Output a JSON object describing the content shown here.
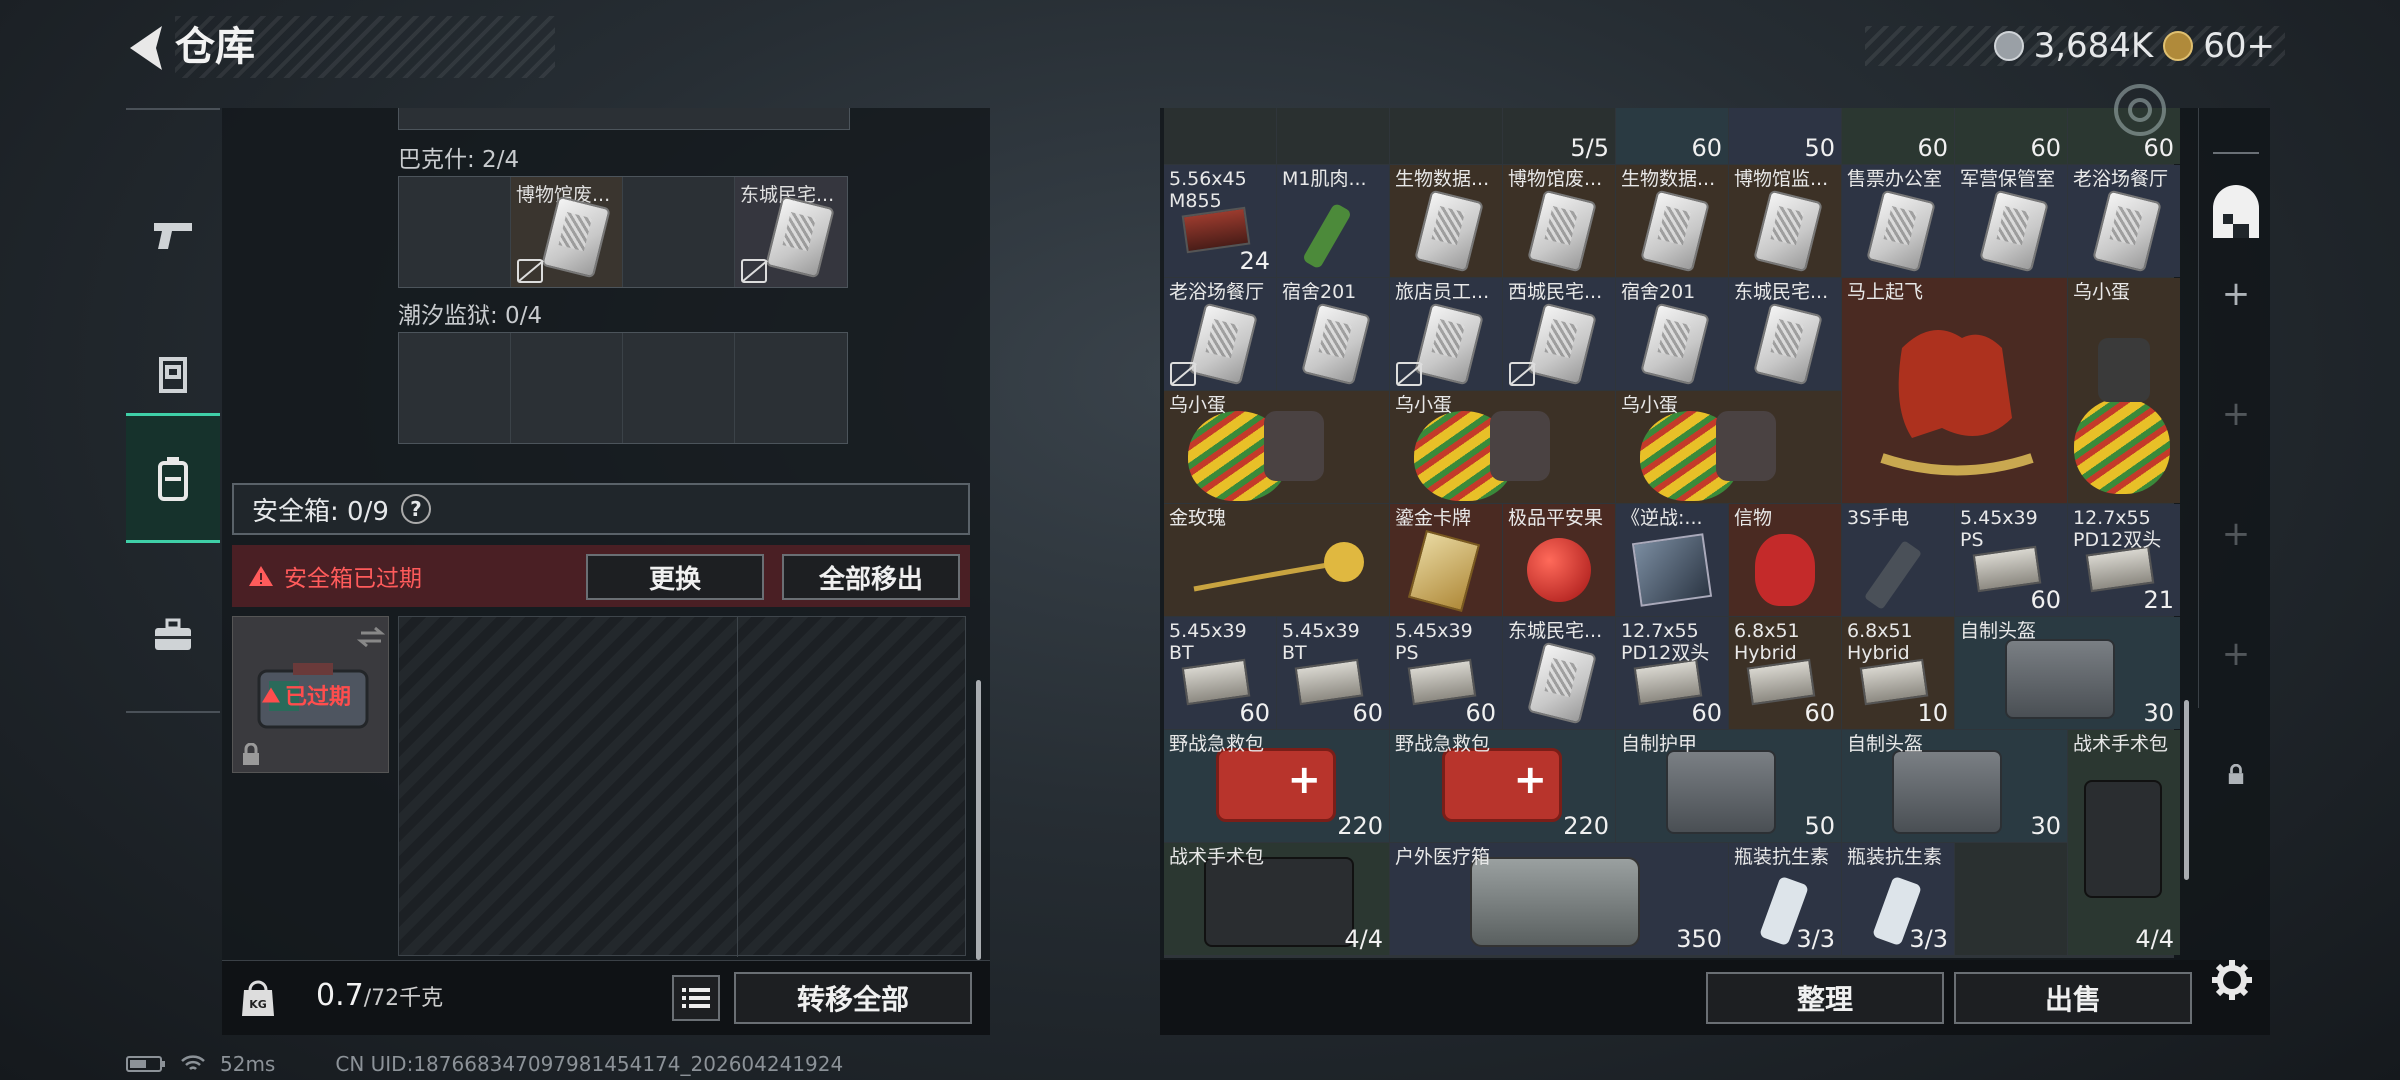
{
  "header": {
    "title": "仓库",
    "currency": "3,684K",
    "tokens": "60+"
  },
  "left_nav": [
    {
      "icon": "pistol-icon"
    },
    {
      "icon": "armor-icon"
    },
    {
      "icon": "backpack-icon"
    },
    {
      "icon": "toolbox-icon"
    }
  ],
  "left_panel": {
    "bakeshi_label": "巴克什: 2/4",
    "bakeshi_items": [
      "博物馆废...",
      "东城民宅..."
    ],
    "prison_label": "潮汐监狱: 0/4",
    "safebox_label": "安全箱: 0/9",
    "safebox_help": "?",
    "expired_warning": "安全箱已过期",
    "replace_button": "更换",
    "move_all_out_button": "全部移出",
    "case_status": "已过期",
    "weight_value": "0.7",
    "weight_max": "/72千克",
    "transfer_all_button": "转移全部"
  },
  "status_bar": {
    "ping": "52ms",
    "uid": "CN UID:187668347097981454174_202604241924"
  },
  "inventory": {
    "top_row_counts": [
      "5/5",
      "60",
      "50",
      "60",
      "60",
      "60"
    ],
    "items": [
      {
        "name": "5.56x45 M855",
        "count": "24"
      },
      {
        "name": "M1肌肉..."
      },
      {
        "name": "生物数据..."
      },
      {
        "name": "博物馆废..."
      },
      {
        "name": "生物数据..."
      },
      {
        "name": "博物馆监..."
      },
      {
        "name": "售票办公室"
      },
      {
        "name": "军营保管室"
      },
      {
        "name": "老浴场餐厅"
      },
      {
        "name": "老浴场餐厅"
      },
      {
        "name": "宿舍201"
      },
      {
        "name": "旅店员工..."
      },
      {
        "name": "西城民宅..."
      },
      {
        "name": "宿舍201"
      },
      {
        "name": "东城民宅..."
      },
      {
        "name": "马上起飞"
      },
      {
        "name": "乌小蛋"
      },
      {
        "name": "乌小蛋"
      },
      {
        "name": "乌小蛋"
      },
      {
        "name": "乌小蛋"
      },
      {
        "name": "金玫瑰"
      },
      {
        "name": "鎏金卡牌"
      },
      {
        "name": "极品平安果"
      },
      {
        "name": "《逆战:..."
      },
      {
        "name": "信物"
      },
      {
        "name": "3S手电"
      },
      {
        "name": "5.45x39 PS",
        "count": "60"
      },
      {
        "name": "12.7x55 PD12双头",
        "count": "21"
      },
      {
        "name": "5.45x39 BT",
        "count": "60"
      },
      {
        "name": "5.45x39 BT",
        "count": "60"
      },
      {
        "name": "5.45x39 PS",
        "count": "60"
      },
      {
        "name": "东城民宅..."
      },
      {
        "name": "12.7x55 PD12双头",
        "count": "60"
      },
      {
        "name": "6.8x51 Hybrid",
        "count": "60"
      },
      {
        "name": "6.8x51 Hybrid",
        "count": "10"
      },
      {
        "name": "自制头盔",
        "count": "30"
      },
      {
        "name": "野战急救包",
        "count": "220"
      },
      {
        "name": "野战急救包",
        "count": "220"
      },
      {
        "name": "自制护甲",
        "count": "50"
      },
      {
        "name": "自制头盔",
        "count": "30"
      },
      {
        "name": "战术手术包",
        "count": "4/4"
      },
      {
        "name": "战术手术包",
        "count": "4/4"
      },
      {
        "name": "户外医疗箱",
        "count": "350"
      },
      {
        "name": "瓶装抗生素",
        "count": "3/3"
      },
      {
        "name": "瓶装抗生素",
        "count": "3/3"
      }
    ],
    "sort_button": "整理",
    "sell_button": "出售"
  }
}
